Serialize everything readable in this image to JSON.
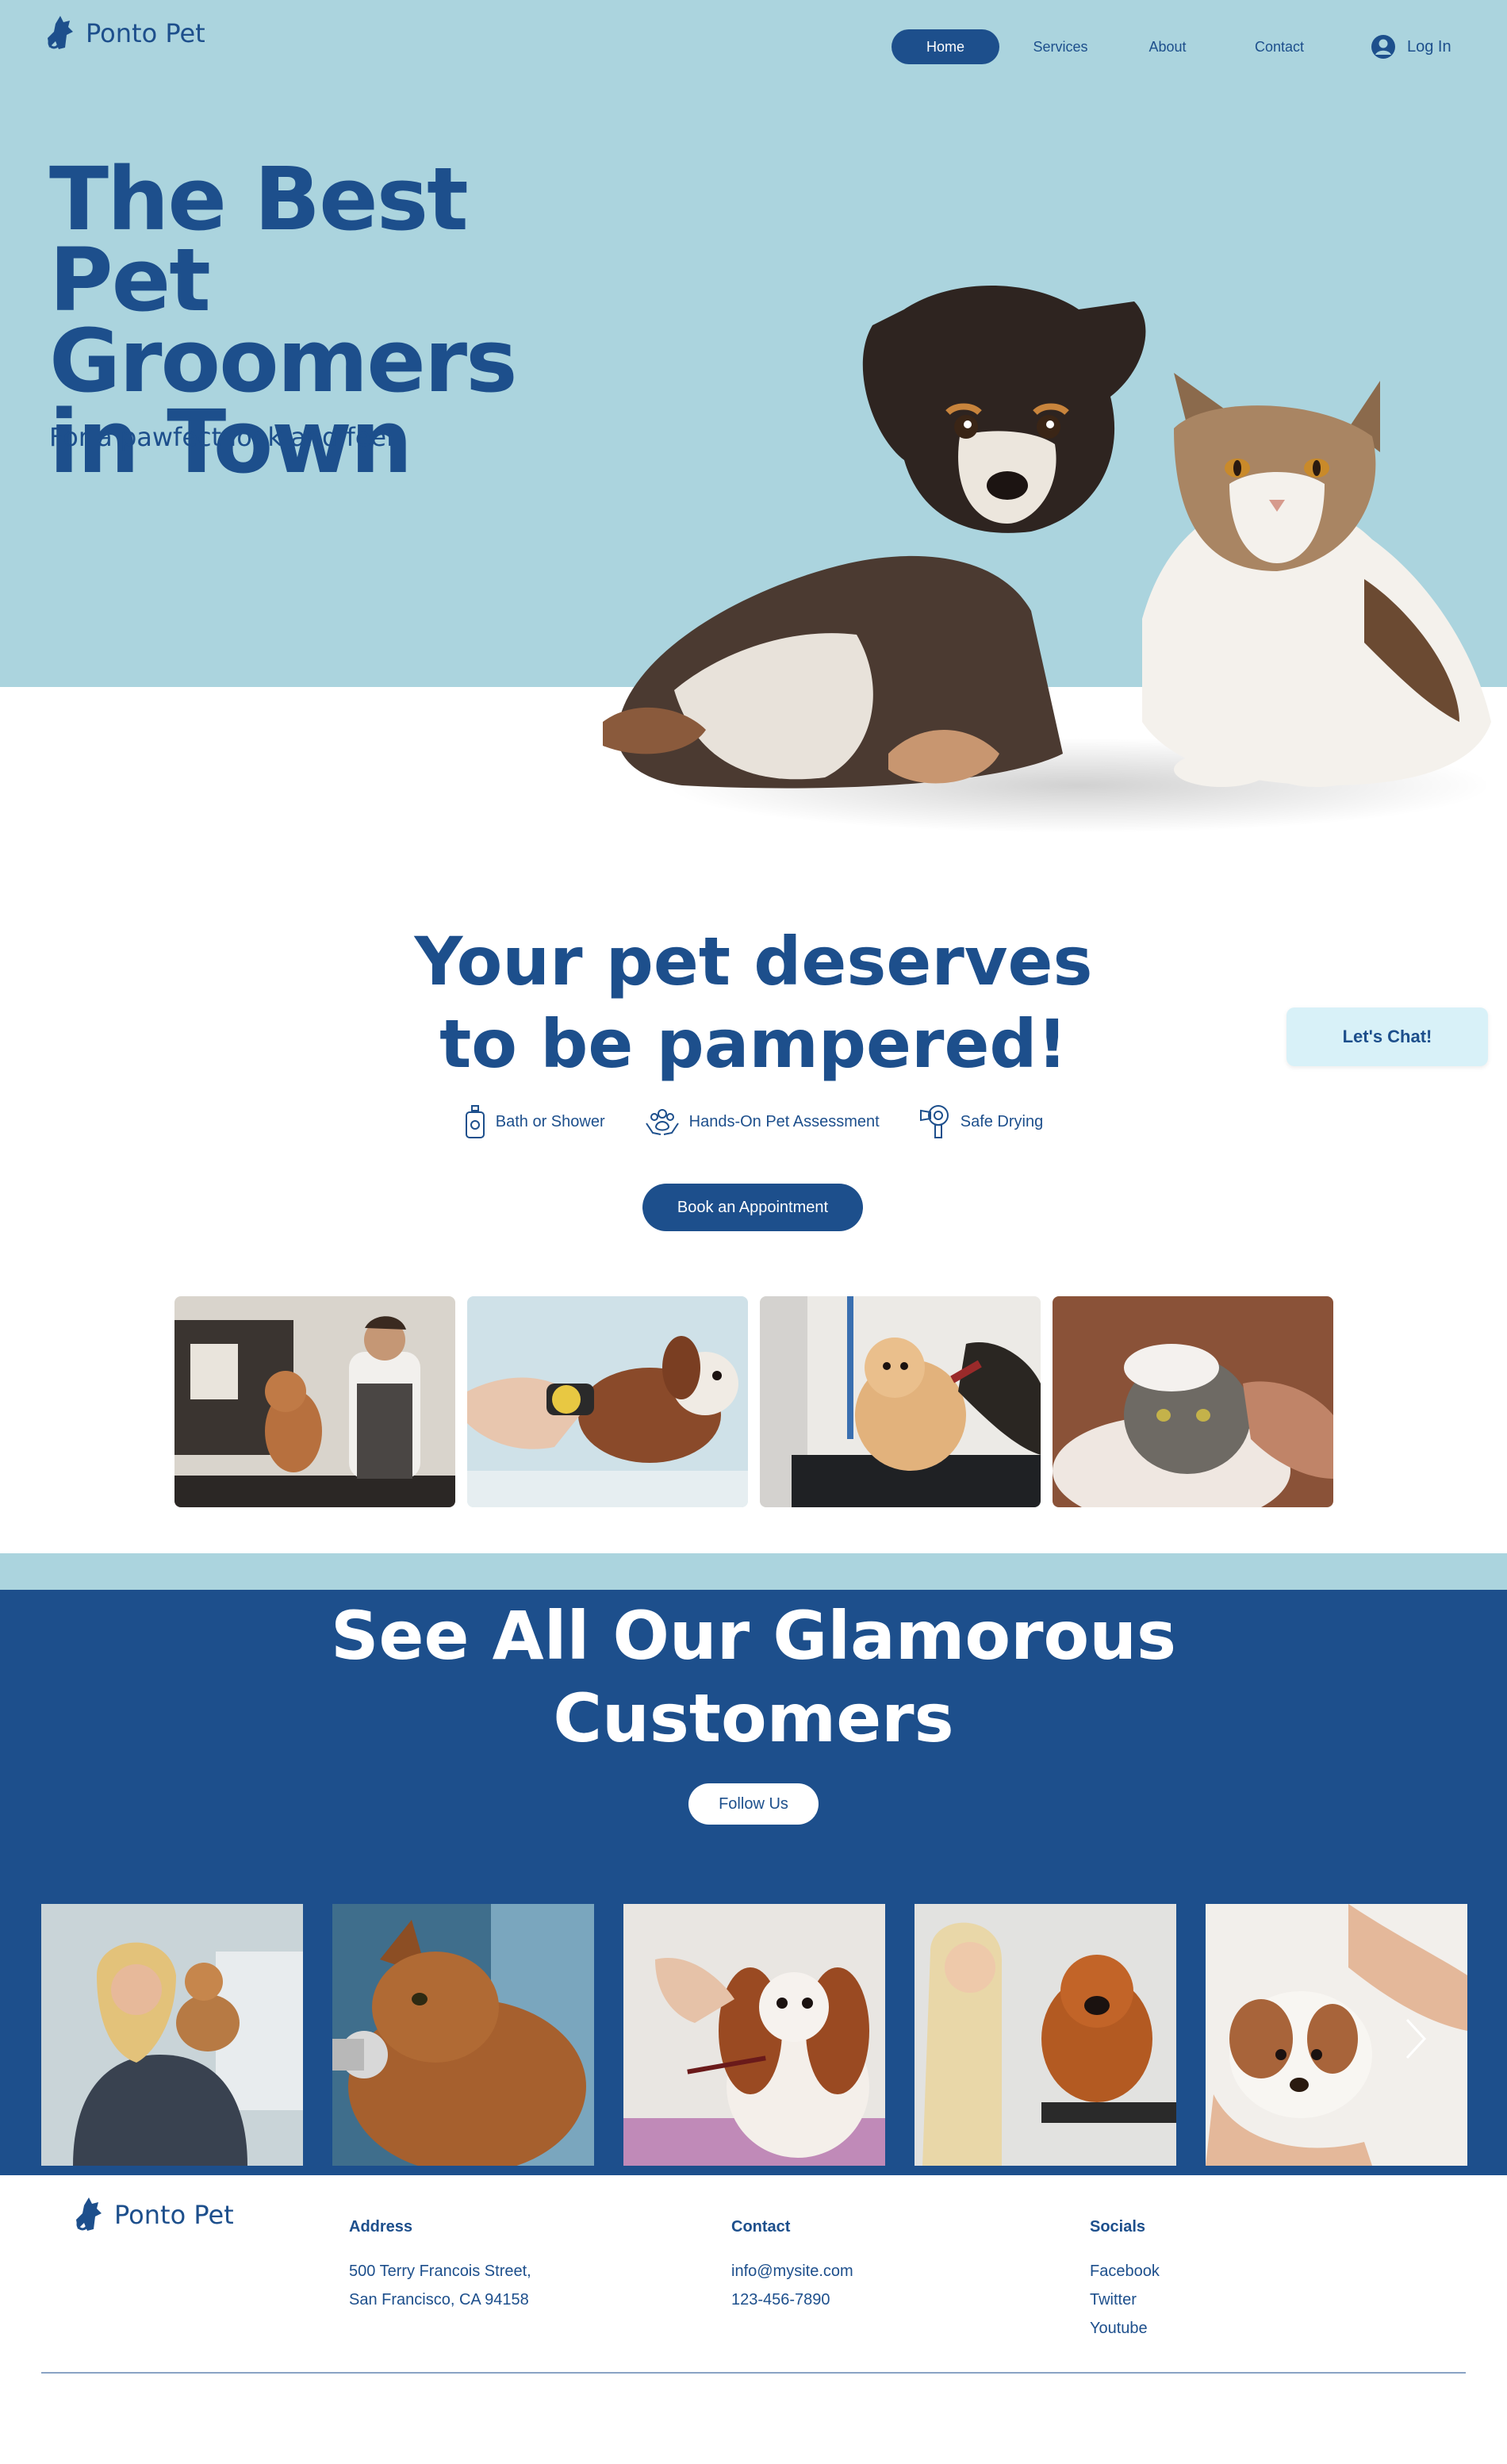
{
  "brand": {
    "name": "Ponto Pet"
  },
  "nav": {
    "home": "Home",
    "services": "Services",
    "about": "About",
    "contact": "Contact",
    "login": "Log In"
  },
  "hero": {
    "title_line1": "The Best Pet",
    "title_line2": "Groomers",
    "title_line3": "in Town",
    "subtitle": "For a pawfect look and feel"
  },
  "pamper": {
    "title_line1": "Your pet deserves",
    "title_line2": "to be pampered!",
    "features": [
      {
        "icon": "shampoo-bottle-icon",
        "label": "Bath or Shower"
      },
      {
        "icon": "paw-hands-icon",
        "label": "Hands-On Pet Assessment"
      },
      {
        "icon": "hair-dryer-icon",
        "label": "Safe Drying"
      }
    ],
    "book_button": "Book an Appointment"
  },
  "chat": {
    "label": "Let's Chat!"
  },
  "customers": {
    "title_line1": "See All Our Glamorous",
    "title_line2": "Customers",
    "follow_button": "Follow Us"
  },
  "footer": {
    "address_heading": "Address",
    "address_line1": "500 Terry Francois Street,",
    "address_line2": "San Francisco, CA 94158",
    "contact_heading": "Contact",
    "email": "info@mysite.com",
    "phone": "123-456-7890",
    "socials_heading": "Socials",
    "facebook": "Facebook",
    "twitter": "Twitter",
    "youtube": "Youtube"
  },
  "colors": {
    "brand_blue": "#1d4f8c",
    "hero_bg": "#abd4de",
    "chat_bg": "#d8f1f8",
    "white": "#ffffff"
  }
}
